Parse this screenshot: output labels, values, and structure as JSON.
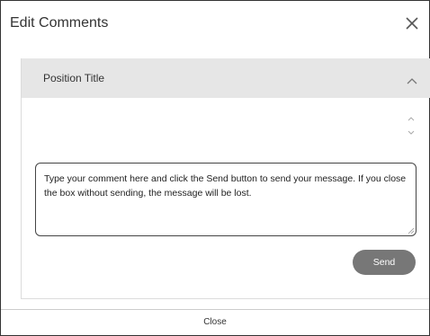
{
  "dialog": {
    "title": "Edit Comments",
    "close_icon": "close-x-icon"
  },
  "panel": {
    "title": "Position Title",
    "chevron_icon": "chevron-up-icon",
    "scroll_icon": "scroll-arrows-icon"
  },
  "comment": {
    "text": "Type your comment here and click the Send button to send your message. If you close the box without sending, the message will be lost."
  },
  "actions": {
    "send_label": "Send"
  },
  "footer": {
    "close_label": "Close"
  },
  "colors": {
    "panel_header_bg": "#e6e6e6",
    "send_button_bg": "#777777",
    "border": "#333333"
  }
}
